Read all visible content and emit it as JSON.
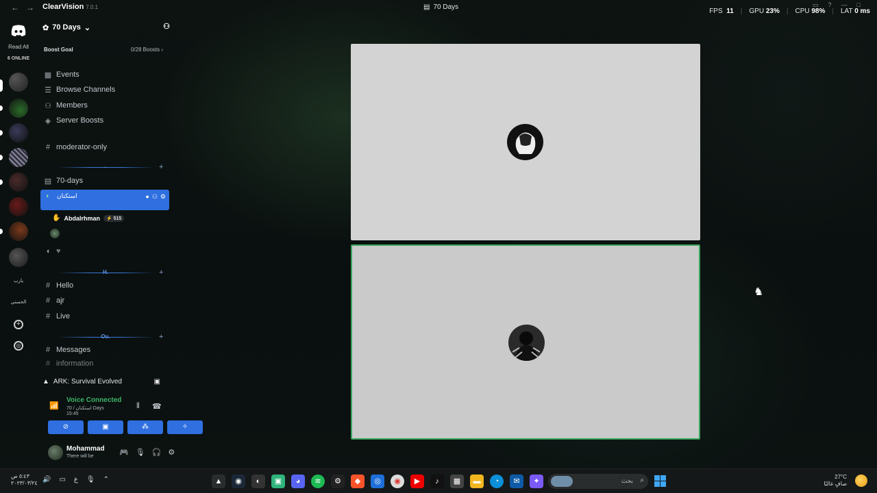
{
  "titlebar": {
    "app_name": "ClearVision",
    "version": "7.0.1",
    "channel_title": "70 Days",
    "stats": {
      "fps_label": "FPS",
      "fps": "11",
      "gpu_label": "GPU",
      "gpu": "23%",
      "cpu_label": "CPU",
      "cpu": "98%",
      "lat_label": "LAT",
      "lat": "0 ms"
    }
  },
  "rail": {
    "read_all": "Read All",
    "online": "6 ONLINE",
    "text_server_1": "يارب",
    "text_server_2": "الحسني"
  },
  "guild": {
    "name": "70 Days",
    "boost_goal": "Boost Goal",
    "boost_count": "0/28 Boosts",
    "menu": {
      "events": "Events",
      "browse_channels": "Browse Channels",
      "members": "Members",
      "server_boosts": "Server Boosts"
    },
    "channels": {
      "moderator_only": "moderator-only",
      "forum_70_days": "70-days",
      "active_voice": "استكنان",
      "voice_user": "Abdalrhman",
      "voice_user_badge": "515",
      "hello": "Hello",
      "ajr": "ajr",
      "live": "Live",
      "messages": "Messages",
      "information": "information"
    },
    "categories": {
      "cat1": "..",
      "cat2": "H.",
      "cat3": "Ou."
    }
  },
  "activity": {
    "game": "ARK: Survival Evolved"
  },
  "voice_panel": {
    "status": "Voice Connected",
    "location": "استكنان / 70 Days",
    "time": "15:45"
  },
  "user": {
    "name": "Mohammad",
    "status": "There will be"
  },
  "taskbar": {
    "clock_time": "٥:٤٣ ص",
    "clock_date": "٢٠٢٣/٠٣/٢٤",
    "lang": "ع",
    "search_placeholder": "بحث",
    "weather_temp": "27°C",
    "weather_desc": "صافٍ غالبًا"
  }
}
